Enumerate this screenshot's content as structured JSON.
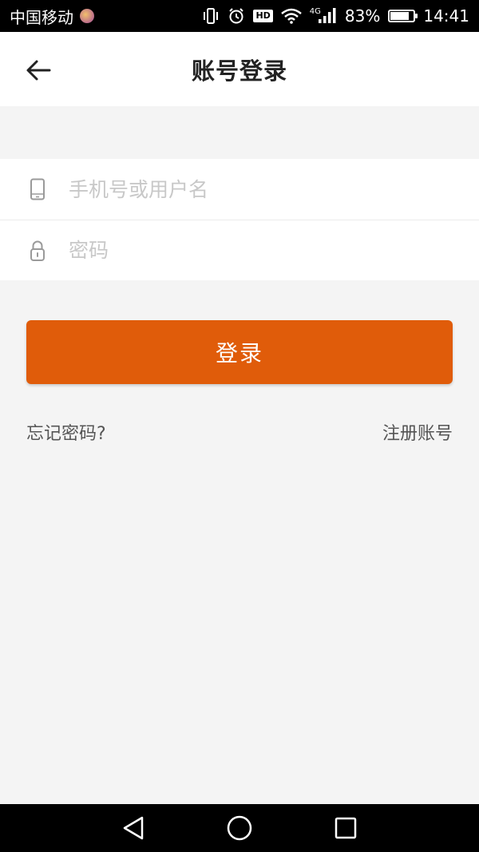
{
  "status_bar": {
    "carrier": "中国移动",
    "network_label": "4G",
    "hd_label": "HD",
    "battery_percent": "83%",
    "battery_level": 0.83,
    "time": "14:41",
    "icons": [
      "vibrate-icon",
      "alarm-icon",
      "hd-icon",
      "wifi-icon",
      "signal-icon",
      "battery-icon"
    ]
  },
  "header": {
    "title": "账号登录",
    "back_icon": "arrow-left-icon"
  },
  "form": {
    "username": {
      "icon": "phone-icon",
      "placeholder": "手机号或用户名",
      "value": ""
    },
    "password": {
      "icon": "lock-icon",
      "placeholder": "密码",
      "value": ""
    }
  },
  "login_button": {
    "label": "登录",
    "color": "#e05c0a"
  },
  "links": {
    "forgot": "忘记密码?",
    "register": "注册账号"
  },
  "nav_bar": {
    "icons": [
      "back-triangle-icon",
      "home-circle-icon",
      "recents-square-icon"
    ]
  },
  "colors": {
    "background": "#f4f4f4",
    "accent": "#e05c0a",
    "title_text": "#222222",
    "link_text": "#555555",
    "placeholder_text": "#c8c8c8"
  }
}
